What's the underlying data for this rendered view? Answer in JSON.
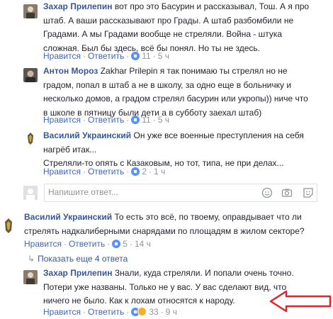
{
  "comments": [
    {
      "author": "Захар Прилепин",
      "body": [
        "вот про это Басурин и рассказывал, Тош. А я про",
        "штаб. А ваши рассказывают про Грады. А штаб разбомбили не",
        "Градами. А мы Градами вообще не стреляли. Война - штука",
        "сложная. Был бы здесь, всё бы понял. Но ты не здесь."
      ],
      "like_label": "Нравится",
      "reply_label": "Ответить",
      "count": "11",
      "time": "5 ч"
    },
    {
      "author": "Антон Мороз",
      "body": [
        "Zakhar Prilepin я так понимаю ты стрелял но не",
        "градом, попал в штаб а не в школу, за одно еще в больничку и",
        "несколько домов, а градом стрелял басурин или укропы)) ниче что",
        "в школе в пятницу были дети а в субботу заехал штаб)"
      ],
      "like_label": "Нравится",
      "reply_label": "Ответить",
      "count": "11",
      "time": "5 ч"
    },
    {
      "author": "Василий Украинский",
      "body": [
        "Он уже все военные преступления на себя",
        "нагрёб итак...",
        "Стреляли-то опять с Казаковым, но тот, типа, не при делах..."
      ],
      "like_label": "Нравится",
      "reply_label": "Ответить",
      "count": "2",
      "time": "1 ч"
    },
    {
      "author": "Василий Украинский",
      "body": [
        "То есть это всё, по твоему, оправдывает что ли",
        "стрелять надкалиберными снарядами по площадям в жилом секторе?"
      ],
      "like_label": "Нравится",
      "reply_label": "Ответить",
      "count": "5",
      "time": "14 ч"
    },
    {
      "author": "Захар Прилепин",
      "body": [
        "Знали, куда стреляли. И попали очень точно.",
        "Потери уже названы. Только не у вас. У вас сделают вид, что",
        "ничего не было. Как к лохам относятся к народу."
      ],
      "like_label": "Нравится",
      "reply_label": "Ответить",
      "count": "33",
      "time": "9 ч"
    }
  ],
  "reply_box": {
    "placeholder": "Напишите ответ..."
  },
  "show_more": "Показать еще 4 ответа",
  "colors": {
    "author": "#365899",
    "link": "#4267b2",
    "meta": "#90949c",
    "arrow": "#e0262b"
  },
  "icons": [
    "emoji-icon",
    "camera-icon",
    "gif-icon",
    "sticker-icon",
    "reply-arrow-icon",
    "red-arrow-annotation"
  ]
}
